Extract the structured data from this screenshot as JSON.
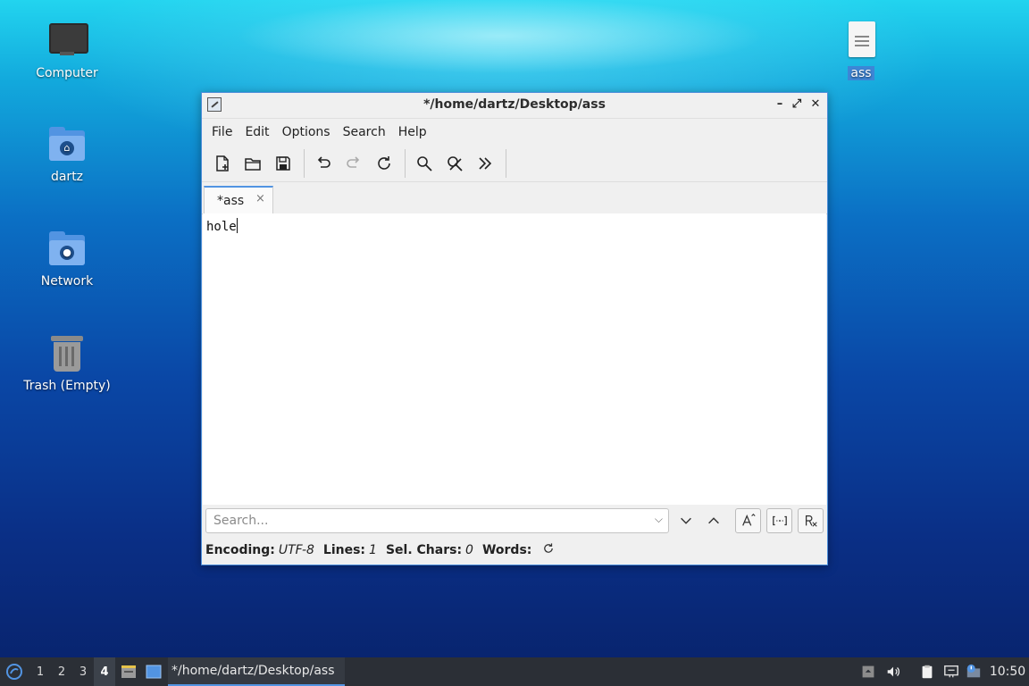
{
  "desktop": {
    "icons": [
      {
        "label": "Computer"
      },
      {
        "label": "dartz"
      },
      {
        "label": "Network"
      },
      {
        "label": "Trash (Empty)"
      },
      {
        "label": "ass"
      }
    ]
  },
  "window": {
    "title": "*/home/dartz/Desktop/ass",
    "controls": {
      "minimize": "–",
      "maximize": "⤢",
      "close": "✕"
    },
    "menu": [
      "File",
      "Edit",
      "Options",
      "Search",
      "Help"
    ],
    "tab": {
      "label": "*ass",
      "close": "×"
    },
    "editor_text": "hole",
    "search": {
      "placeholder": "Search...",
      "value": ""
    },
    "status": {
      "encoding_label": "Encoding:",
      "encoding_value": "UTF-8",
      "lines_label": "Lines:",
      "lines_value": "1",
      "sel_label": "Sel. Chars:",
      "sel_value": "0",
      "words_label": "Words:"
    }
  },
  "taskbar": {
    "workspaces": [
      "1",
      "2",
      "3",
      "4"
    ],
    "active_workspace": "4",
    "task_title": "*/home/dartz/Desktop/ass",
    "clock": "10:50"
  },
  "colors": {
    "accent": "#5294e2",
    "taskbar": "#2b2f36"
  }
}
